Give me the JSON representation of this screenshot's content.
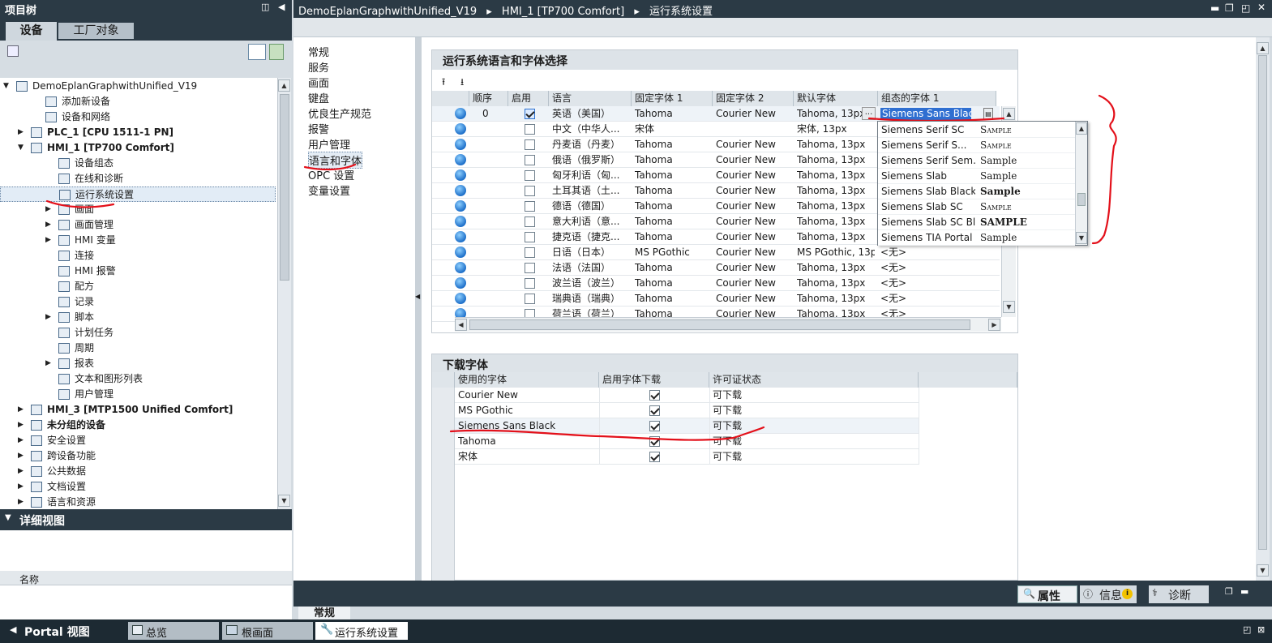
{
  "project_tree": {
    "title": "项目树",
    "tabs": [
      "设备",
      "工厂对象"
    ],
    "items": [
      {
        "label": "DemoEplanGraphwithUnified_V19",
        "indent": 0,
        "exp": "▼"
      },
      {
        "label": "添加新设备",
        "indent": 2,
        "exp": ""
      },
      {
        "label": "设备和网络",
        "indent": 2,
        "exp": ""
      },
      {
        "label": "PLC_1 [CPU 1511-1 PN]",
        "indent": 1,
        "exp": "▶",
        "bold": true
      },
      {
        "label": "HMI_1 [TP700 Comfort]",
        "indent": 1,
        "exp": "▼",
        "bold": true
      },
      {
        "label": "设备组态",
        "indent": 3,
        "exp": ""
      },
      {
        "label": "在线和诊断",
        "indent": 3,
        "exp": ""
      },
      {
        "label": "运行系统设置",
        "indent": 3,
        "exp": "",
        "selected": true
      },
      {
        "label": "画面",
        "indent": 3,
        "exp": "▶"
      },
      {
        "label": "画面管理",
        "indent": 3,
        "exp": "▶"
      },
      {
        "label": "HMI 变量",
        "indent": 3,
        "exp": "▶"
      },
      {
        "label": "连接",
        "indent": 3,
        "exp": ""
      },
      {
        "label": "HMI 报警",
        "indent": 3,
        "exp": ""
      },
      {
        "label": "配方",
        "indent": 3,
        "exp": ""
      },
      {
        "label": "记录",
        "indent": 3,
        "exp": ""
      },
      {
        "label": "脚本",
        "indent": 3,
        "exp": "▶"
      },
      {
        "label": "计划任务",
        "indent": 3,
        "exp": ""
      },
      {
        "label": "周期",
        "indent": 3,
        "exp": ""
      },
      {
        "label": "报表",
        "indent": 3,
        "exp": "▶"
      },
      {
        "label": "文本和图形列表",
        "indent": 3,
        "exp": ""
      },
      {
        "label": "用户管理",
        "indent": 3,
        "exp": ""
      },
      {
        "label": "HMI_3 [MTP1500 Unified Comfort]",
        "indent": 1,
        "exp": "▶",
        "bold": true
      },
      {
        "label": "未分组的设备",
        "indent": 1,
        "exp": "▶",
        "bold": true
      },
      {
        "label": "安全设置",
        "indent": 1,
        "exp": "▶"
      },
      {
        "label": "跨设备功能",
        "indent": 1,
        "exp": "▶"
      },
      {
        "label": "公共数据",
        "indent": 1,
        "exp": "▶"
      },
      {
        "label": "文档设置",
        "indent": 1,
        "exp": "▶"
      },
      {
        "label": "语言和资源",
        "indent": 1,
        "exp": "▶"
      }
    ]
  },
  "detail_view": {
    "title": "详细视图",
    "col_name": "名称"
  },
  "breadcrumb": {
    "parts": [
      "DemoEplanGraphwithUnified_V19",
      "HMI_1 [TP700 Comfort]",
      "运行系统设置"
    ]
  },
  "left_nav": [
    "常规",
    "服务",
    "画面",
    "键盘",
    "优良生产规范",
    "报警",
    "用户管理",
    "语言和字体",
    "OPC 设置",
    "变量设置"
  ],
  "lang_section": {
    "title": "运行系统语言和字体选择",
    "headers": [
      "顺序",
      "启用",
      "语言",
      "固定字体 1",
      "固定字体 2",
      "默认字体",
      "组态的字体 1"
    ],
    "rows": [
      {
        "order": "0",
        "enabled": true,
        "lang": "英语（美国）",
        "f1": "Tahoma",
        "f2": "Courier New",
        "def": "Tahoma, 13px",
        "cfg": "Siemens Sans Black"
      },
      {
        "order": "",
        "enabled": false,
        "lang": "中文（中华人...",
        "f1": "宋体",
        "f2": "",
        "def": "宋体, 13px",
        "cfg": ""
      },
      {
        "order": "",
        "enabled": false,
        "lang": "丹麦语（丹麦）",
        "f1": "Tahoma",
        "f2": "Courier New",
        "def": "Tahoma, 13px",
        "cfg": ""
      },
      {
        "order": "",
        "enabled": false,
        "lang": "俄语（俄罗斯）",
        "f1": "Tahoma",
        "f2": "Courier New",
        "def": "Tahoma, 13px",
        "cfg": ""
      },
      {
        "order": "",
        "enabled": false,
        "lang": "匈牙利语（匈...",
        "f1": "Tahoma",
        "f2": "Courier New",
        "def": "Tahoma, 13px",
        "cfg": ""
      },
      {
        "order": "",
        "enabled": false,
        "lang": "土耳其语（土...",
        "f1": "Tahoma",
        "f2": "Courier New",
        "def": "Tahoma, 13px",
        "cfg": ""
      },
      {
        "order": "",
        "enabled": false,
        "lang": "德语（德国）",
        "f1": "Tahoma",
        "f2": "Courier New",
        "def": "Tahoma, 13px",
        "cfg": ""
      },
      {
        "order": "",
        "enabled": false,
        "lang": "意大利语（意...",
        "f1": "Tahoma",
        "f2": "Courier New",
        "def": "Tahoma, 13px",
        "cfg": ""
      },
      {
        "order": "",
        "enabled": false,
        "lang": "捷克语（捷克...",
        "f1": "Tahoma",
        "f2": "Courier New",
        "def": "Tahoma, 13px",
        "cfg": ""
      },
      {
        "order": "",
        "enabled": false,
        "lang": "日语（日本）",
        "f1": "MS PGothic",
        "f2": "Courier New",
        "def": "MS PGothic, 13px",
        "cfg": "<无>"
      },
      {
        "order": "",
        "enabled": false,
        "lang": "法语（法国）",
        "f1": "Tahoma",
        "f2": "Courier New",
        "def": "Tahoma, 13px",
        "cfg": "<无>"
      },
      {
        "order": "",
        "enabled": false,
        "lang": "波兰语（波兰）",
        "f1": "Tahoma",
        "f2": "Courier New",
        "def": "Tahoma, 13px",
        "cfg": "<无>"
      },
      {
        "order": "",
        "enabled": false,
        "lang": "瑞典语（瑞典）",
        "f1": "Tahoma",
        "f2": "Courier New",
        "def": "Tahoma, 13px",
        "cfg": "<无>"
      },
      {
        "order": "",
        "enabled": false,
        "lang": "荷兰语（荷兰）",
        "f1": "Tahoma",
        "f2": "Courier New",
        "def": "Tahoma, 13px",
        "cfg": "<无>"
      }
    ],
    "dropdown": [
      {
        "name": "Siemens Serif SC",
        "sample": "Sample"
      },
      {
        "name": "Siemens Serif S...",
        "sample": "Sample"
      },
      {
        "name": "Siemens Serif Sem...",
        "sample": "Sample"
      },
      {
        "name": "Siemens Slab",
        "sample": "Sample"
      },
      {
        "name": "Siemens Slab Black",
        "sample": "Sample"
      },
      {
        "name": "Siemens Slab SC",
        "sample": "Sample"
      },
      {
        "name": "Siemens Slab SC Bl...",
        "sample": "SAMPLE"
      },
      {
        "name": "Siemens TIA Portal ...",
        "sample": "Sample"
      }
    ]
  },
  "download_section": {
    "title": "下载字体",
    "headers": [
      "使用的字体",
      "启用字体下载",
      "许可证状态"
    ],
    "rows": [
      {
        "font": "Courier New",
        "enabled": true,
        "status": "可下载"
      },
      {
        "font": "MS PGothic",
        "enabled": true,
        "status": "可下载"
      },
      {
        "font": "Siemens Sans Black",
        "enabled": true,
        "status": "可下载"
      },
      {
        "font": "Tahoma",
        "enabled": true,
        "status": "可下载"
      },
      {
        "font": "宋体",
        "enabled": true,
        "status": "可下载"
      }
    ]
  },
  "inspector_tabs": [
    "属性",
    "信息",
    "诊断"
  ],
  "general_tab": "常规",
  "taskbar": {
    "portal": "Portal 视图",
    "items": [
      "总览",
      "根画面",
      "运行系统设置"
    ]
  },
  "colors": {
    "titlebar": "#2b3a45",
    "accent": "#1d6fc9",
    "red_annotation": "#e3101a"
  }
}
